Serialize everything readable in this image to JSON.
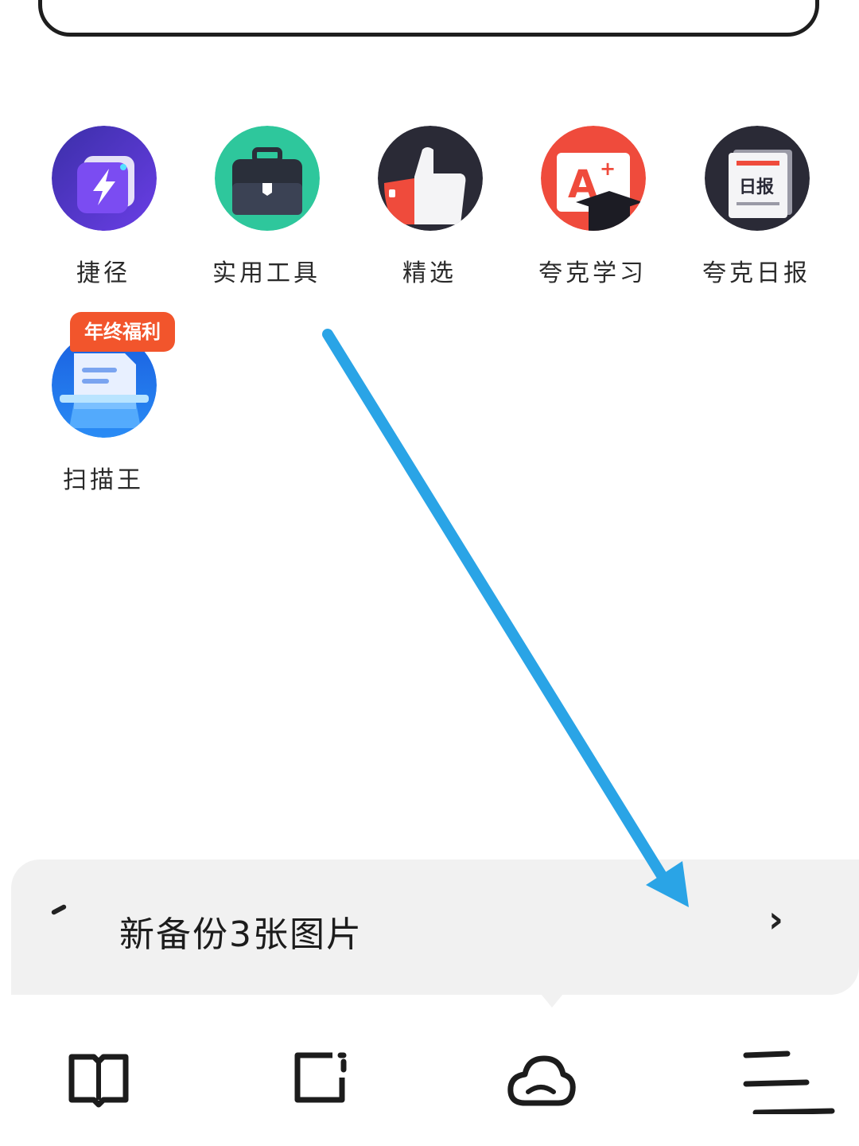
{
  "search": {
    "placeholder": ""
  },
  "apps": [
    {
      "label": "捷径",
      "icon": "lightning-icon",
      "color": "#5b3fd8"
    },
    {
      "label": "实用工具",
      "icon": "toolbox-icon",
      "color": "#2ec79c"
    },
    {
      "label": "精选",
      "icon": "thumbs-up-icon",
      "color": "#2a2a36"
    },
    {
      "label": "夸克学习",
      "icon": "graduation-cap-icon",
      "color": "#ef4b3c"
    },
    {
      "label": "夸克日报",
      "icon": "newspaper-icon",
      "color": "#2a2a36",
      "icon_text": "日报"
    },
    {
      "label": "扫描王",
      "icon": "scanner-icon",
      "color": "#1f72f0",
      "badge": "年终福利"
    }
  ],
  "notice": {
    "text": "新备份3张图片",
    "chevron": "›"
  },
  "bottom_nav": [
    {
      "name": "book-icon"
    },
    {
      "name": "tab-square-icon"
    },
    {
      "name": "cloud-icon"
    },
    {
      "name": "menu-icon"
    }
  ],
  "colors": {
    "arrow": "#2aa4e6",
    "badge": "#f2552c",
    "notice_bg": "#f1f1f1"
  }
}
